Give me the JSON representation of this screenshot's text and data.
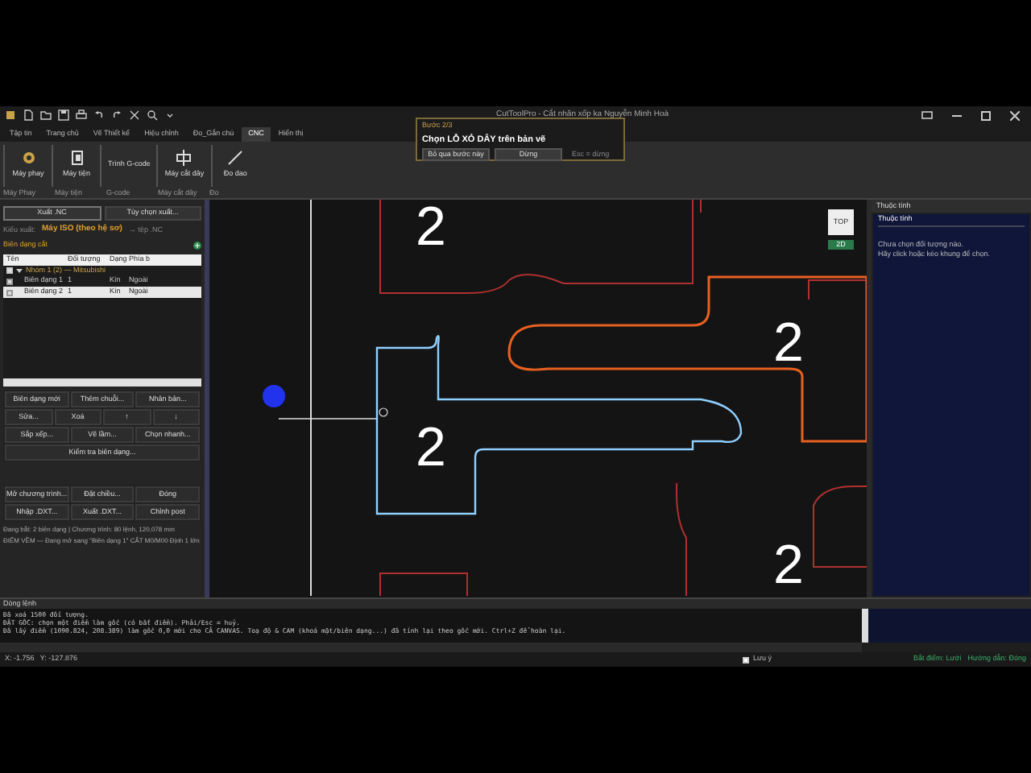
{
  "window": {
    "title": "CutToolPro - Cắt nhãn xốp ka Nguyễn Minh Hoà"
  },
  "menu_tabs": [
    {
      "label": "Tập tin",
      "selected": false
    },
    {
      "label": "Trang chủ",
      "selected": false
    },
    {
      "label": "Vẽ Thiết kế",
      "selected": false
    },
    {
      "label": "Hiệu chỉnh",
      "selected": false
    },
    {
      "label": "Đo_Gắn chú",
      "selected": false
    },
    {
      "label": "CNC",
      "selected": true
    },
    {
      "label": "Hiển thị",
      "selected": false
    }
  ],
  "ribbon": [
    {
      "kind": "mill",
      "label": "Máy phay",
      "group": "Máy Phay"
    },
    {
      "kind": "lathe",
      "label": "Máy tiện",
      "group": "Máy tiện"
    },
    {
      "kind": "text",
      "label": "Trình G-code",
      "group": "G-code"
    },
    {
      "kind": "wire",
      "label": "Máy cắt dây",
      "group": "Máy cắt dây"
    },
    {
      "kind": "measure",
      "label": "Đo dao",
      "group": "Đo"
    }
  ],
  "wizard": {
    "step": "Bước 2/3",
    "message": "Chọn LỖ XỎ DÂY trên bản vẽ",
    "buttons": [
      "Bỏ qua bước này",
      "Dừng"
    ],
    "hint": "Esc = dừng"
  },
  "left_panel": {
    "top_buttons": [
      "Xuất .NC",
      "Tùy chọn xuất..."
    ],
    "export_label": "Kiểu xuất:",
    "export_value": "Máy ISO (theo hệ sơ)",
    "export_target": "→ tệp .NC",
    "section": "Biên dạng cắt",
    "columns": [
      "Tên",
      "Đối tượng",
      "Dạng",
      "Phía b"
    ],
    "group": {
      "label": "Nhóm 1 (2) — Mitsubishi",
      "checked": true,
      "expanded": true,
      "children": [
        {
          "name": "Biên dạng 1",
          "count": "1",
          "shape": "Kín",
          "side": "Ngoài",
          "checked": true,
          "selected": false
        },
        {
          "name": "Biên dạng 2",
          "count": "1",
          "shape": "Kín",
          "side": "Ngoài",
          "checked": true,
          "selected": true
        }
      ]
    },
    "buttons": [
      [
        "Biên dạng mới",
        "Thêm chuỗi...",
        "Nhân bản..."
      ],
      [
        "Sửa...",
        "Xoá",
        "↑",
        "↓"
      ],
      [
        "Sắp xếp...",
        "Vẽ lầm...",
        "Chọn nhanh..."
      ],
      [
        "Kiểm tra biên dạng..."
      ]
    ],
    "buttons2": [
      [
        "Mở chương trình...",
        "Đặt chiều...",
        "Đóng"
      ],
      [
        "Nhập .DXT...",
        "Xuất .DXT...",
        "Chỉnh post"
      ]
    ],
    "info": [
      "Đang bắt: 2 biên dạng | Chương trình: 80 lệnh, 120,078 mm",
      "ĐIỂM VỀM — Đang mở sang \"Biên dạng 1\" CẮT M0/M00 Định 1 lớn"
    ]
  },
  "canvas": {
    "labels": [
      "2",
      "2",
      "2",
      "2"
    ],
    "view_cube": "TOP",
    "view_mode": "2D"
  },
  "properties": {
    "title": "Thuộc tính",
    "header": "Thuộc tính",
    "lines": [
      "Chưa chọn đối tượng nào.",
      "Hãy click hoặc kéo khung để chọn."
    ]
  },
  "command": {
    "title": "Dòng lệnh",
    "lines": [
      "Đã xoá 1500 đối tượng.",
      "ĐẶT GỐC: chọn một điểm làm gốc (có bắt điểm). Phải/Esc = huỷ.",
      "Đã lấy điểm (1090.824, 208.389) làm gốc 0,0 mới cho CẢ CANVAS. Toạ độ & CAM (khoá mặt/biên dạng...) đã tính lại theo gốc mới. Ctrl+Z để hoàn lại."
    ]
  },
  "status_bar": {
    "coords": "X: -1.756   Y: -127.876",
    "note": {
      "label": "Lưu ý",
      "checked": false
    },
    "snap": "Bắt điểm: Lưới",
    "guide": "Hướng dẫn: Đóng"
  }
}
